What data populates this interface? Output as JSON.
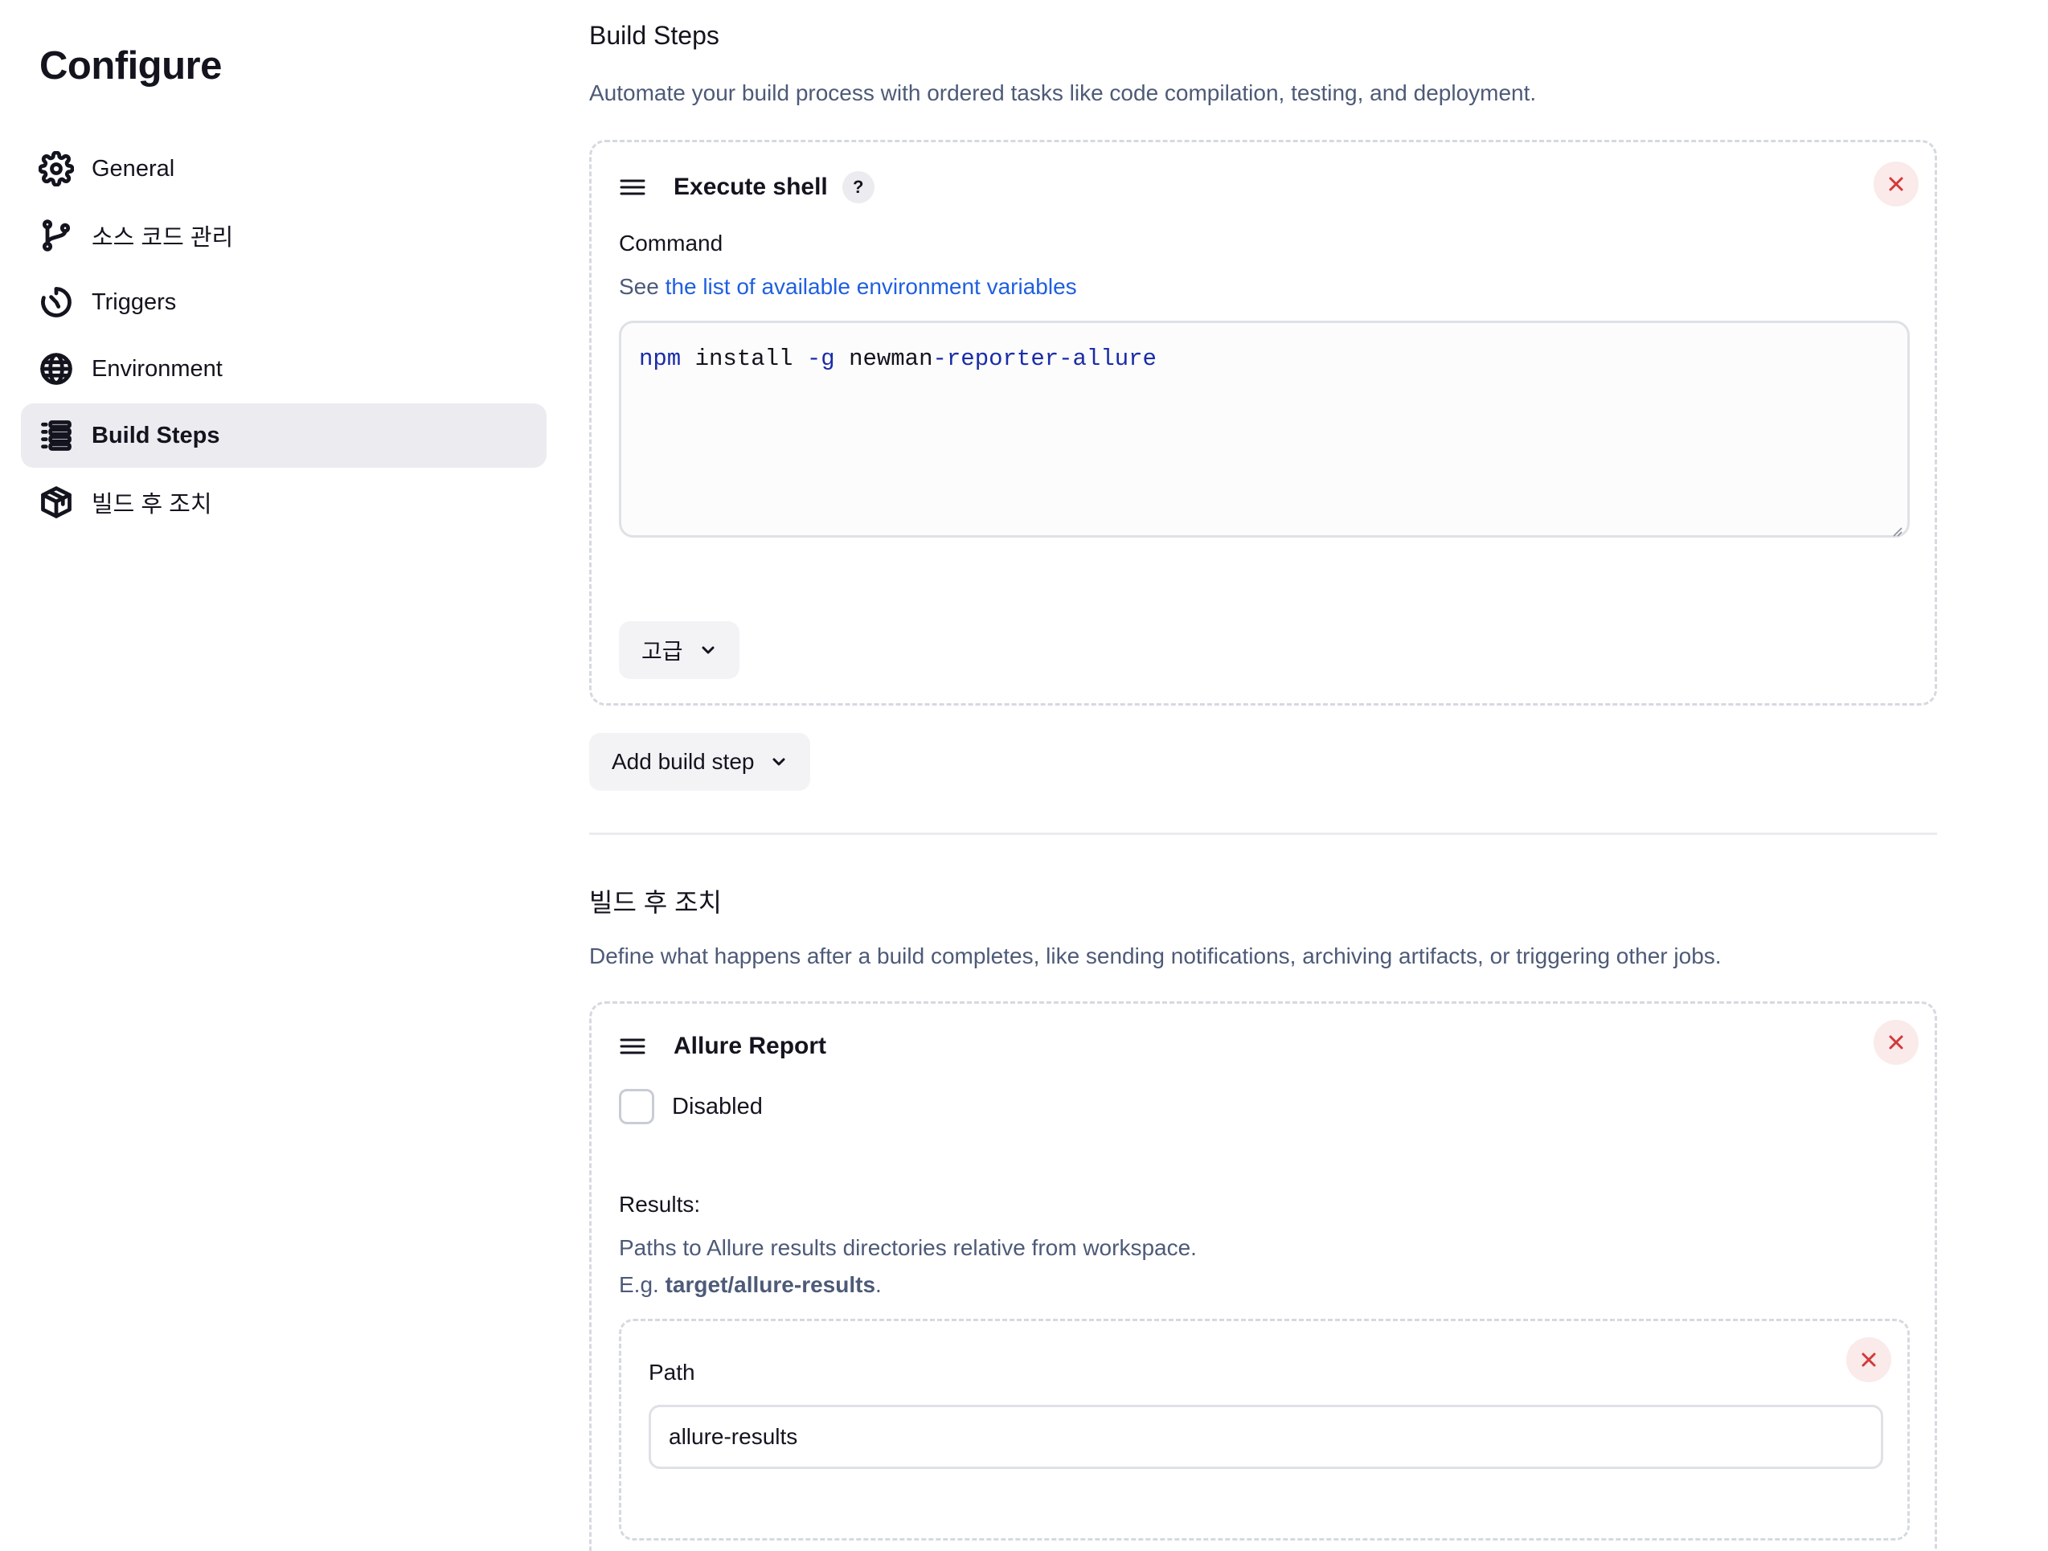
{
  "sidebar": {
    "title": "Configure",
    "items": [
      {
        "label": "General",
        "icon": "gear-icon"
      },
      {
        "label": "소스 코드 관리",
        "icon": "git-branch-icon"
      },
      {
        "label": "Triggers",
        "icon": "timer-icon"
      },
      {
        "label": "Environment",
        "icon": "globe-icon"
      },
      {
        "label": "Build Steps",
        "icon": "list-icon",
        "active": true
      },
      {
        "label": "빌드 후 조치",
        "icon": "package-icon"
      }
    ]
  },
  "build_steps": {
    "title": "Build Steps",
    "description": "Automate your build process with ordered tasks like code compilation, testing, and deployment.",
    "step": {
      "title": "Execute shell",
      "help": "?",
      "command_label": "Command",
      "hint_prefix": "See ",
      "hint_link": "the list of available environment variables",
      "command_tokens": {
        "t1": "npm",
        "t2": " install ",
        "t3": "-g",
        "t4": " newman",
        "t5": "-reporter-allure"
      },
      "advanced_label": "고급"
    },
    "add_label": "Add build step"
  },
  "post_build": {
    "title": "빌드 후 조치",
    "description": "Define what happens after a build completes, like sending notifications, archiving artifacts, or triggering other jobs.",
    "step": {
      "title": "Allure Report",
      "disabled_label": "Disabled",
      "results_label": "Results:",
      "results_hint": "Paths to Allure results directories relative from workspace.",
      "example_prefix": "E.g. ",
      "example_value": "target/allure-results",
      "example_suffix": ".",
      "path_label": "Path",
      "path_value": "allure-results"
    }
  },
  "colors": {
    "accent_link": "#1f5fe0",
    "active_nav_bg": "#ebebf0",
    "close_icon": "#d33a3a",
    "muted_text": "#4d5a78"
  }
}
